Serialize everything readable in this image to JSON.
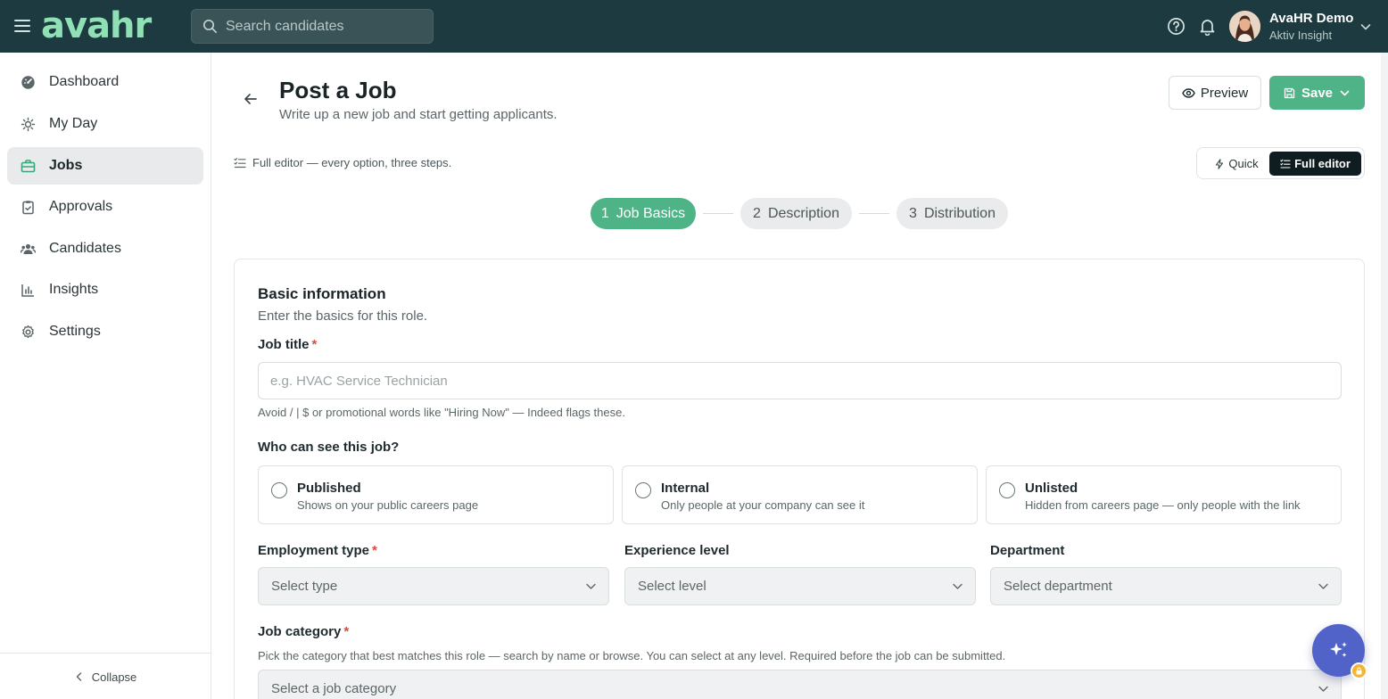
{
  "app": {
    "brand": "avahr",
    "search_placeholder": "Search candidates",
    "user": {
      "name": "AvaHR Demo",
      "org": "Aktiv Insight"
    }
  },
  "sidebar": {
    "items": [
      {
        "label": "Dashboard",
        "icon": "dashboard-icon"
      },
      {
        "label": "My Day",
        "icon": "sun-icon"
      },
      {
        "label": "Jobs",
        "icon": "briefcase-icon",
        "active": true
      },
      {
        "label": "Approvals",
        "icon": "clipboard-check-icon"
      },
      {
        "label": "Candidates",
        "icon": "users-icon"
      },
      {
        "label": "Insights",
        "icon": "bar-chart-icon"
      },
      {
        "label": "Settings",
        "icon": "gear-icon"
      }
    ],
    "collapse_label": "Collapse"
  },
  "header": {
    "title": "Post a Job",
    "subtitle": "Write up a new job and start getting applicants.",
    "preview_label": "Preview",
    "save_label": "Save"
  },
  "mode": {
    "note": "Full editor — every option, three steps.",
    "quick_label": "Quick",
    "full_label": "Full editor",
    "selected": "Full editor"
  },
  "steps": [
    {
      "num": "1",
      "label": "Job Basics",
      "active": true
    },
    {
      "num": "2",
      "label": "Description",
      "active": false
    },
    {
      "num": "3",
      "label": "Distribution",
      "active": false
    }
  ],
  "form": {
    "section_title": "Basic information",
    "section_subtitle": "Enter the basics for this role.",
    "job_title": {
      "label": "Job title",
      "required_mark": "*",
      "placeholder": "e.g. HVAC Service Technician",
      "value": "",
      "help": "Avoid / | $ or promotional words like \"Hiring Now\" — Indeed flags these."
    },
    "visibility": {
      "label": "Who can see this job?",
      "options": [
        {
          "title": "Published",
          "desc": "Shows on your public careers page",
          "selected": false
        },
        {
          "title": "Internal",
          "desc": "Only people at your company can see it",
          "selected": false
        },
        {
          "title": "Unlisted",
          "desc": "Hidden from careers page — only people with the link",
          "selected": false
        }
      ]
    },
    "employment_type": {
      "label": "Employment type",
      "required_mark": "*",
      "placeholder": "Select type"
    },
    "experience_level": {
      "label": "Experience level",
      "placeholder": "Select level"
    },
    "department": {
      "label": "Department",
      "placeholder": "Select department"
    },
    "job_category": {
      "label": "Job category",
      "required_mark": "*",
      "help": "Pick the category that best matches this role — search by name or browse. You can select at any level. Required before the job can be submitted.",
      "placeholder": "Select a job category"
    }
  },
  "colors": {
    "topbar": "#1c3a3f",
    "brand": "#8fe0b4",
    "accent": "#4eb487",
    "required": "#e0483e",
    "assistant": "#5163c9"
  }
}
